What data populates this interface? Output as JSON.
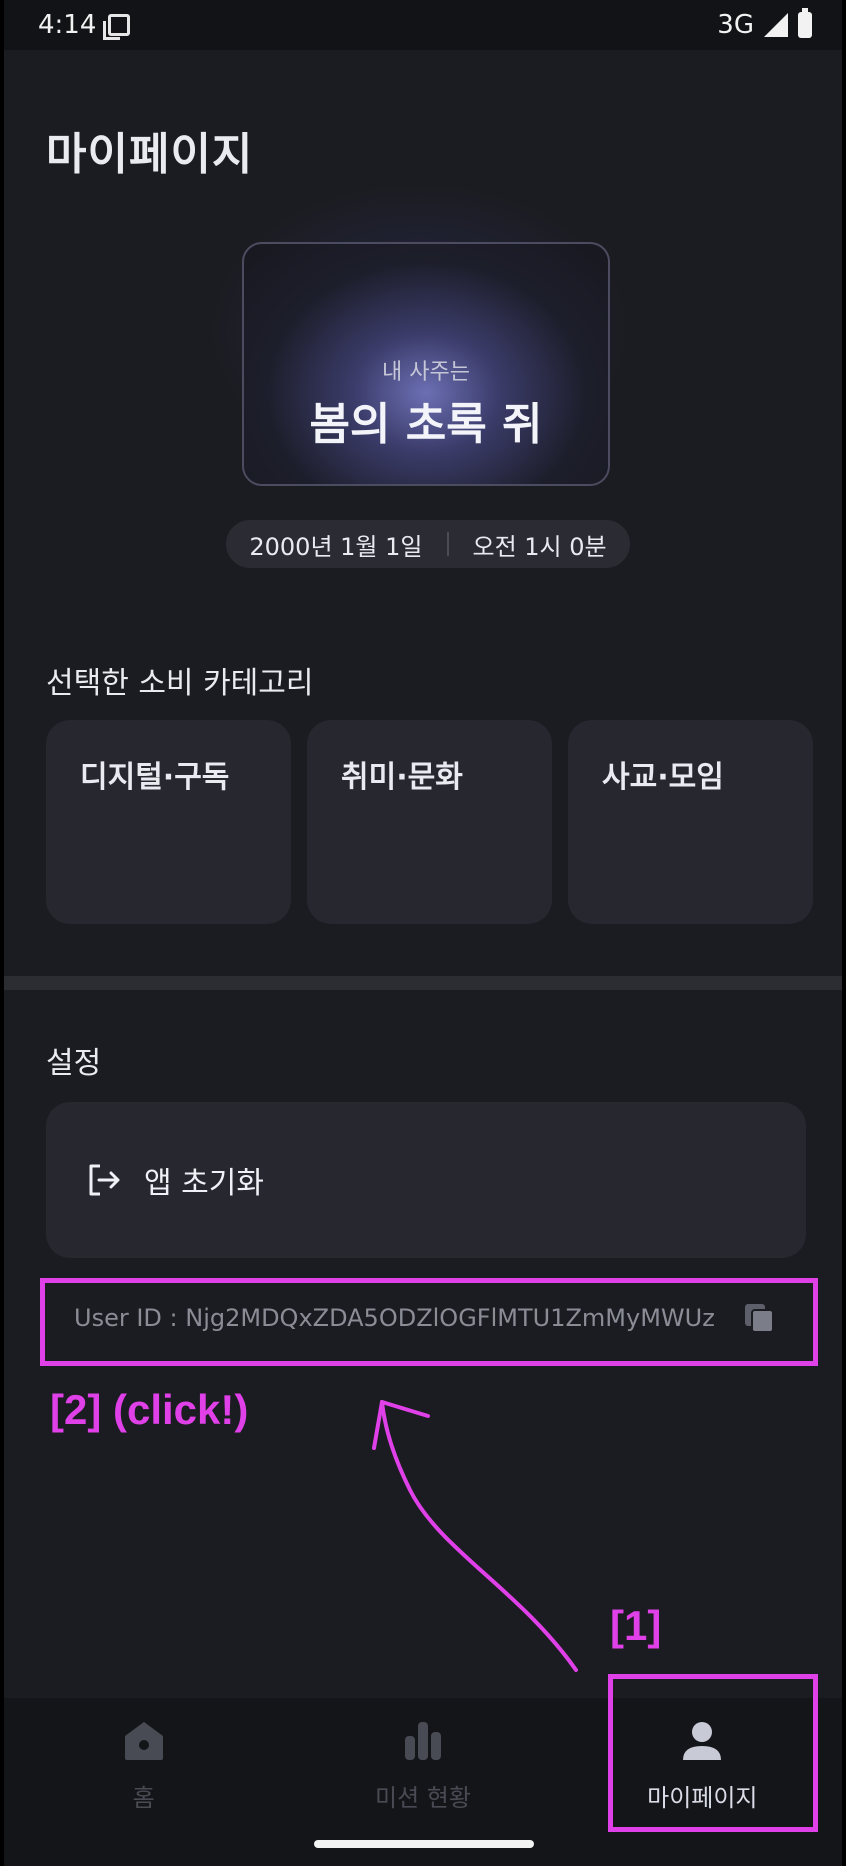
{
  "status_bar": {
    "time": "4:14",
    "network": "3G"
  },
  "page": {
    "title": "마이페이지"
  },
  "saju": {
    "subtitle": "내 사주는",
    "result": "봄의 초록 쥐"
  },
  "birth": {
    "date": "2000년 1월 1일",
    "time": "오전 1시 0분"
  },
  "categories": {
    "title": "선택한 소비 카테고리",
    "items": [
      {
        "label": "디지털·구독"
      },
      {
        "label": "취미·문화"
      },
      {
        "label": "사교·모임"
      }
    ]
  },
  "settings": {
    "title": "설정",
    "reset_label": "앱 초기화",
    "user_id_text": "User ID : Njg2MDQxZDA5ODZlOGFlMTU1ZmMyMWUz"
  },
  "annotations": {
    "step1": "[1]",
    "step2": "[2]  (click!)",
    "color": "#e040e8"
  },
  "bottom_nav": {
    "items": [
      {
        "label": "홈",
        "icon": "home-icon",
        "active": false
      },
      {
        "label": "미션 현황",
        "icon": "bar-chart-icon",
        "active": false
      },
      {
        "label": "마이페이지",
        "icon": "person-icon",
        "active": true
      }
    ]
  },
  "colors": {
    "background": "#1b1c21",
    "card": "#26272f",
    "accent_annotation": "#e040e8",
    "nav_inactive": "#494b54"
  }
}
